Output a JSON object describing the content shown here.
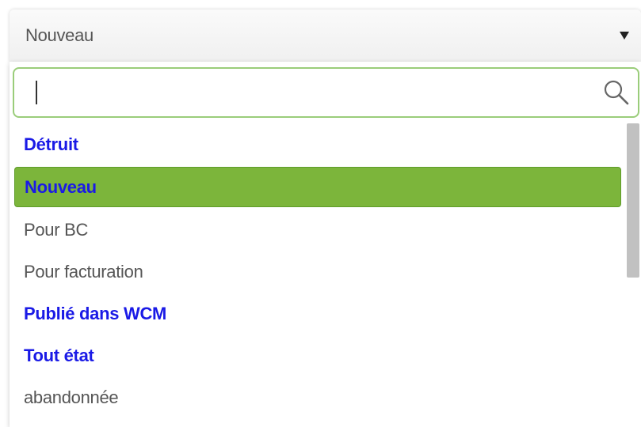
{
  "select": {
    "value": "Nouveau"
  },
  "search": {
    "value": "",
    "placeholder": ""
  },
  "options": [
    {
      "label": "Détruit",
      "style": "bold"
    },
    {
      "label": "Nouveau",
      "style": "selected"
    },
    {
      "label": "Pour BC",
      "style": "normal"
    },
    {
      "label": "Pour facturation",
      "style": "normal"
    },
    {
      "label": "Publié dans WCM",
      "style": "bold"
    },
    {
      "label": "Tout état",
      "style": "bold"
    },
    {
      "label": "abandonnée",
      "style": "normal"
    }
  ],
  "colors": {
    "selected_bg": "#7cb53b",
    "bold_text": "#1a1ae6",
    "search_border": "#9acd7a"
  },
  "icons": {
    "search": "search-icon",
    "dropdown": "caret-down-icon"
  }
}
